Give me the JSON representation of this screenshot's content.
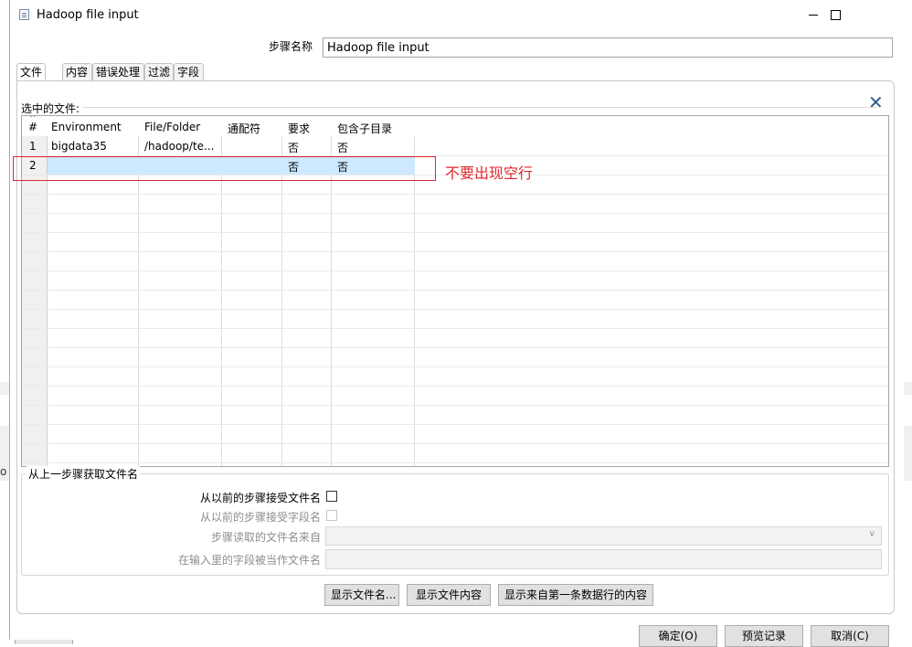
{
  "window": {
    "title": "Hadoop file input"
  },
  "step": {
    "label": "步骤名称",
    "value": "Hadoop file input"
  },
  "tabs": [
    "文件",
    "内容",
    "错误处理",
    "过滤",
    "字段"
  ],
  "files": {
    "label": "选中的文件:",
    "columns": [
      "#",
      "Environment",
      "File/Folder",
      "通配符",
      "要求",
      "包含子目录"
    ],
    "rows": [
      {
        "num": "1",
        "environment": "bigdata35",
        "path": "/hadoop/te...",
        "wildcard": "",
        "required": "否",
        "subdir": "否"
      },
      {
        "num": "2",
        "environment": "",
        "path": "",
        "wildcard": "",
        "required": "否",
        "subdir": "否"
      }
    ]
  },
  "annotation": {
    "text": "不要出现空行"
  },
  "from_previous": {
    "title": "从上一步骤获取文件名",
    "accept_filenames": "从以前的步骤接受文件名",
    "accept_fields": "从以前的步骤接受字段名",
    "read_from_step": "步骤读取的文件名来自",
    "field_as_filename": "在输入里的字段被当作文件名"
  },
  "buttons": {
    "show_filenames": "显示文件名...",
    "show_content": "显示文件内容",
    "show_first_row": "显示来自第一条数据行的内容"
  },
  "bottom_buttons": {
    "ok": "确定(O)",
    "preview": "预览记录",
    "cancel": "取消(C)"
  },
  "colors": {
    "annotation": "#e0262b",
    "selection": "#cde8ff",
    "close_x": "#2a5d8c"
  }
}
